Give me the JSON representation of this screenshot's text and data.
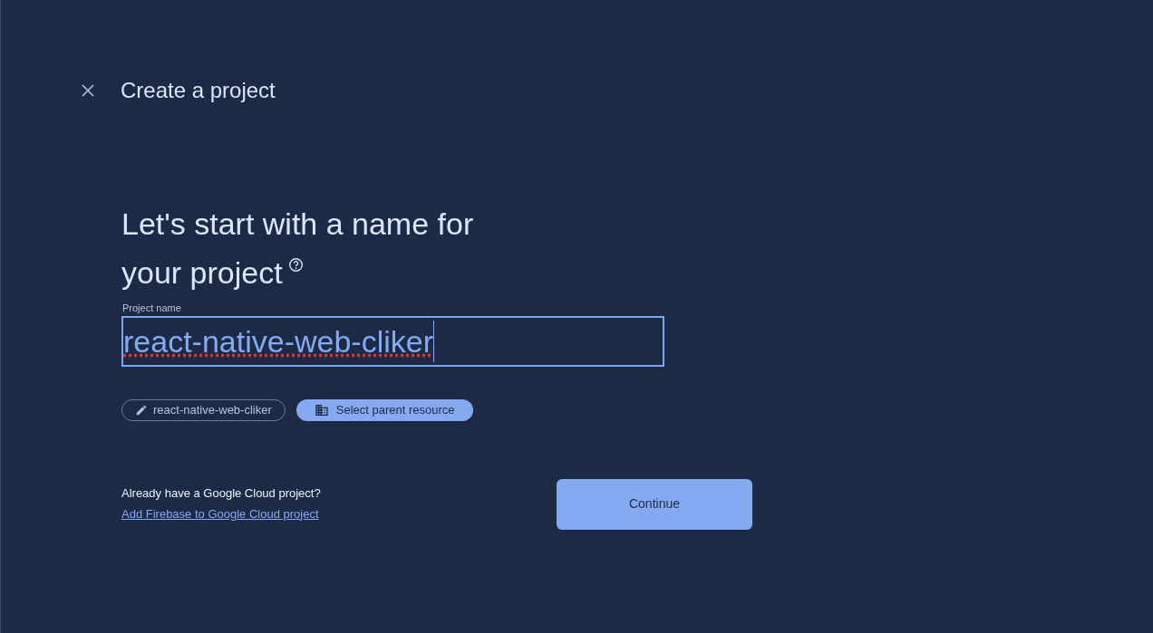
{
  "header": {
    "title": "Create a project"
  },
  "heading": {
    "line_1": "Let's start with a name for",
    "line_2": "your project"
  },
  "name_field": {
    "label": "Project name",
    "value": "react-native-web-cliker",
    "focused": true
  },
  "chips": [
    {
      "kind": "edit",
      "label": "react-native-web-cliker",
      "selected": false
    },
    {
      "kind": "resource",
      "label": "Select parent resource",
      "selected": true
    }
  ],
  "footer": {
    "question": "Already have a Google Cloud project?",
    "link": "Add Firebase to Google Cloud project",
    "continue_button": "Continue"
  }
}
